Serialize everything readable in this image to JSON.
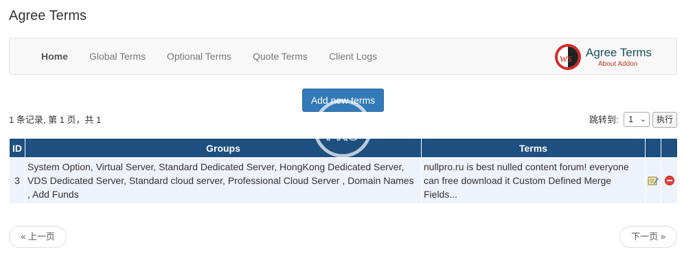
{
  "page": {
    "title": "Agree Terms"
  },
  "nav": {
    "items": [
      {
        "label": "Home",
        "active": true
      },
      {
        "label": "Global Terms",
        "active": false
      },
      {
        "label": "Optional Terms",
        "active": false
      },
      {
        "label": "Quote Terms",
        "active": false
      },
      {
        "label": "Client Logs",
        "active": false
      }
    ],
    "brand": {
      "logo_text": "ws",
      "title": "Agree Terms",
      "subtitle": "About Addon"
    }
  },
  "toolbar": {
    "add_label": "Add new terms"
  },
  "pagination_top": {
    "info": "1 条记录, 第 1 页，共 1",
    "jump_label": "跳转到:",
    "jump_value": "1",
    "go_label": "执行"
  },
  "table": {
    "headers": {
      "id": "ID",
      "groups": "Groups",
      "terms": "Terms"
    },
    "rows": [
      {
        "id": "3",
        "groups": "System Option, Virtual Server, Standard Dedicated Server, HongKong Dedicated Server, VDS Dedicated Server, Standard cloud server, Professional Cloud Server , Domain Names , Add Funds",
        "terms": "nullpro.ru is best nulled content forum!   everyone can free download it   Custom Defined Merge Fields..."
      }
    ]
  },
  "pager": {
    "prev_label": "« 上一页",
    "next_label": "下一页 »"
  },
  "watermark": {
    "text": "PRO"
  },
  "colors": {
    "header_bg": "#1d4f7f",
    "row_bg": "#eef2fa",
    "primary_button": "#337ab7"
  }
}
